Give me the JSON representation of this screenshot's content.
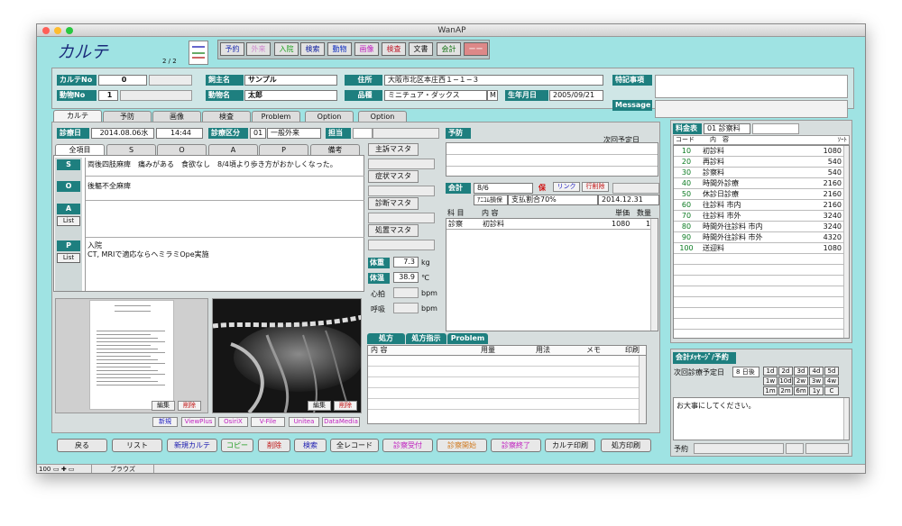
{
  "window": {
    "title": "WanAP"
  },
  "header": {
    "title": "カルテ",
    "page": "2 / 2"
  },
  "toolbar": [
    {
      "label": "予約",
      "color": "#2030b0"
    },
    {
      "label": "外来",
      "color": "#d08ad0"
    },
    {
      "label": "入院",
      "color": "#20a020"
    },
    {
      "label": "検索",
      "color": "#1020a0"
    },
    {
      "label": "動物",
      "color": "#1030c0"
    },
    {
      "label": "画像",
      "color": "#c020c0"
    },
    {
      "label": "検査",
      "color": "#c02030"
    },
    {
      "label": "文書",
      "color": "#101010"
    },
    {
      "label": "会計",
      "color": "#107010"
    },
    {
      "label": "ーー",
      "color": "#ffffff"
    }
  ],
  "info": {
    "karte_no_label": "カルテNo",
    "karte_no": "0",
    "animal_no_label": "動物No",
    "animal_no": "1",
    "owner_label": "飼主名",
    "owner": "サンプル",
    "animal_name_label": "動物名",
    "animal_name": "太郎",
    "address_label": "住所",
    "address": "大阪市北区本庄西１−１−３",
    "breed_label": "品種",
    "breed": "ミニチュア・ダックス",
    "sex": "M",
    "birth_label": "生年月日",
    "birth": "2005/09/21",
    "special_label": "特記事項",
    "message_label": "Message"
  },
  "tabs": [
    "カルテ",
    "予防",
    "画像",
    "検査",
    "Problem",
    "Option",
    "Option"
  ],
  "visit": {
    "date_label": "診療日",
    "date": "2014.08.06水",
    "time": "14:44",
    "type_label": "診療区分",
    "type_code": "01",
    "type": "一般外来",
    "staff_label": "担当"
  },
  "soap_tabs": [
    "全項目",
    "S",
    "O",
    "A",
    "P",
    "備考"
  ],
  "soap": {
    "s_label": "S",
    "s": "両後四肢麻痺　痛みがある　食欲なし　8/4頃より歩き方がおかしくなった。",
    "o_label": "O",
    "o": "後軀不全麻痺",
    "a_label": "A",
    "list_label": "List",
    "p_label": "P",
    "p1": "入院",
    "p2": "CT, MRIで適応ならヘミラミOpe実施"
  },
  "masters": [
    "主訴マスタ",
    "症状マスタ",
    "診断マスタ",
    "処置マスタ"
  ],
  "vitals": {
    "weight_label": "体重",
    "weight": "7.3",
    "weight_unit": "kg",
    "temp_label": "体温",
    "temp": "38.9",
    "temp_unit": "℃",
    "heart_label": "心拍",
    "heart_unit": "bpm",
    "resp_label": "呼吸",
    "resp_unit": "bpm"
  },
  "yobou": {
    "label": "予防",
    "next_label": "次回予定日"
  },
  "kaikei": {
    "label": "会計",
    "date": "8/6",
    "ho": "保",
    "link": "リンク",
    "gyo": "行削除",
    "insurance": "ｱﾆｺﾑ損保",
    "ratio": "支払割合70%",
    "expiry": "2014.12.31",
    "headers": [
      "科 目",
      "内 容",
      "単価",
      "数量"
    ],
    "rows": [
      {
        "cat": "診察",
        "item": "初診料",
        "price": "1080",
        "qty": "1"
      }
    ]
  },
  "images": {
    "edit": "編集",
    "delete": "削除"
  },
  "image_tools": [
    "新規",
    "ViewPlus",
    "OsiriX",
    "V-File",
    "Unitea",
    "DataMedia"
  ],
  "rx": {
    "tabs": [
      "処方",
      "処方指示",
      "Problem"
    ],
    "headers": [
      "内 容",
      "用量",
      "用法",
      "メモ",
      "印刷"
    ]
  },
  "fee": {
    "label": "料金表",
    "selected": "01 診察料",
    "headers": [
      "コード",
      "内　容",
      "ｿｰﾄ"
    ],
    "rows": [
      {
        "code": "10",
        "name": "初診料",
        "price": "1080"
      },
      {
        "code": "20",
        "name": "再診料",
        "price": "540"
      },
      {
        "code": "30",
        "name": "診察料",
        "price": "540"
      },
      {
        "code": "40",
        "name": "時間外診療",
        "price": "2160"
      },
      {
        "code": "50",
        "name": "休診日診療",
        "price": "2160"
      },
      {
        "code": "60",
        "name": "往診料 市内",
        "price": "2160"
      },
      {
        "code": "70",
        "name": "往診料 市外",
        "price": "3240"
      },
      {
        "code": "80",
        "name": "時間外往診料 市内",
        "price": "3240"
      },
      {
        "code": "90",
        "name": "時間外往診料 市外",
        "price": "4320"
      },
      {
        "code": "100",
        "name": "送迎料",
        "price": "1080"
      }
    ]
  },
  "msg": {
    "label": "会計ﾒｯｾｰｼﾞ/予約",
    "next_label": "次回診療予定日",
    "days": "8",
    "days_unit": "日後",
    "quick": [
      "1d",
      "2d",
      "3d",
      "4d",
      "5d",
      "1w",
      "10d",
      "2w",
      "3w",
      "4w",
      "1m",
      "2m",
      "6m",
      "1y",
      "C"
    ],
    "text": "お大事にしてください。",
    "reserve_label": "予約"
  },
  "bottom_buttons": [
    {
      "label": "戻る",
      "color": "#111"
    },
    {
      "label": "リスト",
      "color": "#111"
    },
    {
      "label": "新規カルテ",
      "color": "#1a1ab0"
    },
    {
      "label": "コピー",
      "color": "#1a9a1a"
    },
    {
      "label": "削除",
      "color": "#c01010"
    },
    {
      "label": "検索",
      "color": "#1a1ab0"
    },
    {
      "label": "全レコード",
      "color": "#111"
    },
    {
      "label": "診察受付",
      "color": "#c020c0"
    },
    {
      "label": "診察開始",
      "color": "#d07a20"
    },
    {
      "label": "診察終了",
      "color": "#c020c0"
    },
    {
      "label": "カルテ印刷",
      "color": "#111"
    },
    {
      "label": "処方印刷",
      "color": "#111"
    }
  ],
  "status": {
    "zoom": "100",
    "mode": "ブラウズ"
  }
}
